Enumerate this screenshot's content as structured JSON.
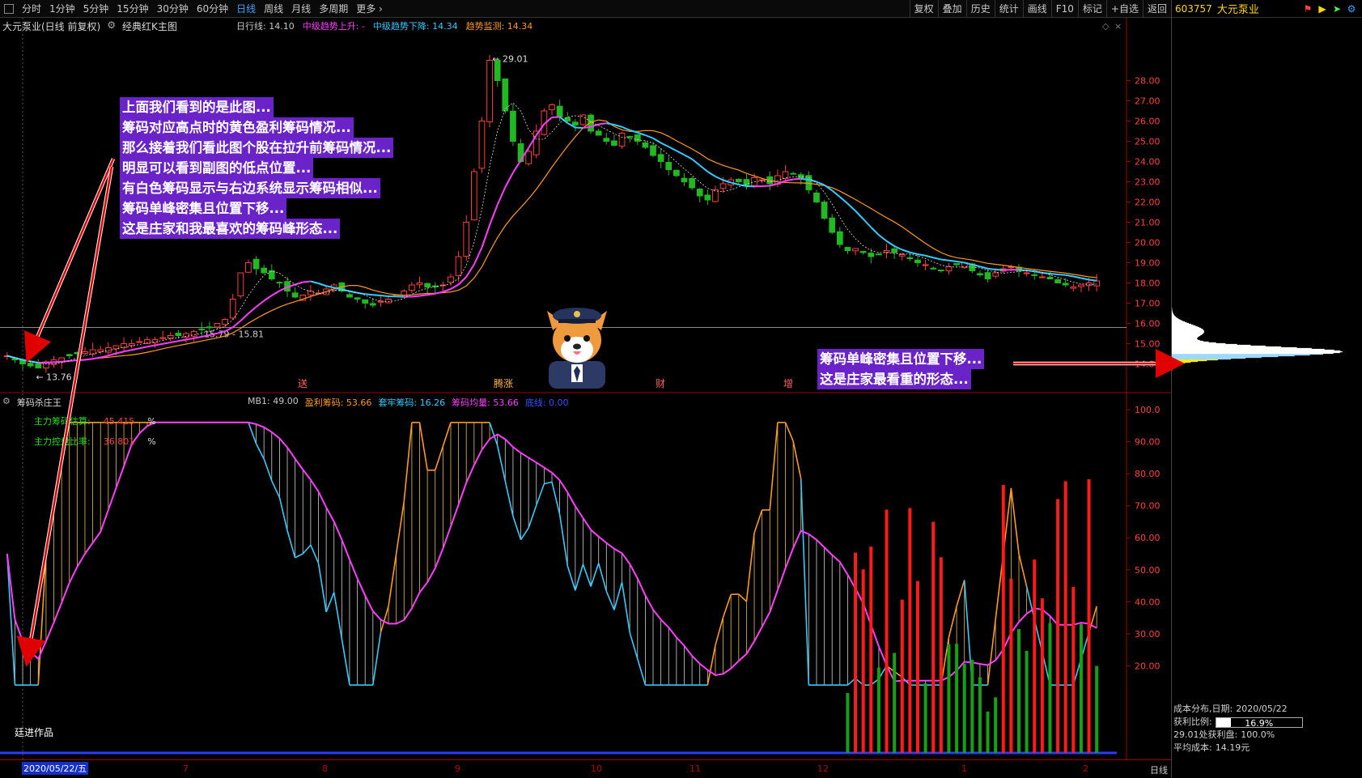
{
  "toolbar": {
    "periods": [
      "分时",
      "1分钟",
      "5分钟",
      "15分钟",
      "30分钟",
      "60分钟",
      "日线",
      "周线",
      "月线",
      "多周期",
      "更多"
    ],
    "active_period": "日线",
    "more_icon": "chevron-right-icon",
    "right_buttons": [
      "复权",
      "叠加",
      "历史",
      "统计",
      "画线",
      "F10",
      "标记",
      "+自选",
      "返回"
    ]
  },
  "stock": {
    "code": "603757",
    "name": "大元泵业",
    "main_title": "大元泵业(日线 前复权)",
    "main_indicator": "经典红K主图"
  },
  "ma_legend": [
    {
      "label": "日行线: 14.10",
      "color": "#c8c8c8"
    },
    {
      "label": "中级趋势上升: -",
      "color": "#ff3cff"
    },
    {
      "label": "中级趋势下降: 14.34",
      "color": "#33ccff"
    },
    {
      "label": "趋势监测: 14.34",
      "color": "#ff9a1f"
    }
  ],
  "price_axis": {
    "labels": [
      "28.00",
      "27.00",
      "26.00",
      "25.00",
      "24.00",
      "23.00",
      "22.00",
      "21.00",
      "20.00",
      "19.00",
      "18.00",
      "17.00",
      "16.00",
      "15.00",
      "14.00"
    ],
    "marker_high": "29.01",
    "marker_low": "13.76",
    "level_label": "15.79 - 15.81"
  },
  "events": [
    {
      "label": "送",
      "color": "#ff6060"
    },
    {
      "label": "腾涨",
      "color": "#ffb040"
    },
    {
      "label": "财",
      "color": "#ff6060"
    },
    {
      "label": "增",
      "color": "#ff6060"
    }
  ],
  "sub_chart": {
    "title": "筹码杀庄王",
    "legend": [
      {
        "label": "MB1: 49.00",
        "color": "#c8c8c8"
      },
      {
        "label": "盈利筹码: 53.66",
        "color": "#ff9a1f"
      },
      {
        "label": "套牢筹码: 16.26",
        "color": "#33ccff"
      },
      {
        "label": "筹码均量: 53.66",
        "color": "#ff3cff"
      },
      {
        "label": "底线: 0.00",
        "color": "#3050ff"
      }
    ],
    "rows": [
      {
        "label": "主力筹码估算:",
        "value": "45.415",
        "unit": "%"
      },
      {
        "label": "主力控盘比率:",
        "value": "36.801",
        "unit": "%"
      }
    ],
    "axis_labels": [
      "100.0",
      "90.00",
      "80.00",
      "70.00",
      "60.00",
      "50.00",
      "40.00",
      "30.00",
      "20.00"
    ],
    "credit": "廷进作品"
  },
  "date_axis": {
    "cursor_date": "2020/05/22/五",
    "months": [
      "7",
      "8",
      "9",
      "10",
      "11",
      "12",
      "1",
      "2"
    ],
    "period": "日线"
  },
  "annotations": {
    "left_note": [
      "上面我们看到的是此图...",
      "筹码对应高点时的黄色盈利筹码情况...",
      "那么接着我们看此图个股在拉升前筹码情况...",
      "明显可以看到副图的低点位置...",
      "有白色筹码显示与右边系统显示筹码相似...",
      "筹码单峰密集且位置下移...",
      "这是庄家和我最喜欢的筹码峰形态..."
    ],
    "right_note": [
      "筹码单峰密集且位置下移...",
      "这是庄家最看重的形态..."
    ]
  },
  "chip_panel": {
    "title": "成本分布,日期:",
    "date": "2020/05/22",
    "profit_ratio_label": "获利比例:",
    "profit_ratio": 16.9,
    "profit_ratio_text": "16.9%",
    "line3": "29.01处获利盘:",
    "line3_value": "100.0%",
    "avg_cost_label": "平均成本:",
    "avg_cost": "14.19元"
  },
  "colors": {
    "up": "#ff3b3b",
    "down": "#22b822",
    "ma_up": "#ff3cff",
    "ma_down": "#33ccff",
    "trend": "#ff9a1f",
    "annotation_bg": "#6a23c9",
    "arrow": "#e00000"
  },
  "chart_data": {
    "type": "candlestick",
    "ylim": [
      13.5,
      29.5
    ],
    "close_series": [
      14.4,
      14.2,
      14.0,
      13.9,
      13.8,
      14.1,
      14.2,
      14.3,
      14.4,
      14.5,
      14.6,
      14.7,
      14.7,
      14.8,
      14.9,
      15.0,
      15.0,
      15.1,
      15.2,
      15.2,
      15.3,
      15.4,
      15.4,
      15.5,
      15.6,
      15.7,
      15.8,
      16.0,
      16.2,
      17.2,
      18.5,
      19.0,
      18.7,
      18.5,
      18.2,
      18.0,
      17.6,
      17.3,
      17.4,
      17.6,
      17.5,
      17.7,
      17.9,
      17.6,
      17.3,
      17.2,
      17.0,
      16.9,
      17.1,
      17.2,
      17.4,
      17.6,
      17.9,
      18.0,
      17.8,
      17.8,
      17.9,
      18.3,
      19.3,
      21.0,
      23.5,
      26.0,
      29.0,
      28.0,
      26.5,
      25.0,
      24.0,
      24.5,
      25.5,
      26.5,
      26.8,
      26.2,
      26.0,
      25.8,
      26.3,
      25.5,
      25.3,
      25.0,
      24.8,
      25.4,
      25.2,
      25.0,
      24.7,
      24.3,
      24.0,
      23.6,
      23.3,
      23.0,
      22.7,
      22.3,
      22.1,
      22.6,
      22.9,
      23.1,
      23.0,
      22.8,
      23.2,
      23.1,
      22.9,
      23.3,
      23.5,
      23.4,
      23.2,
      22.6,
      22.0,
      21.2,
      20.5,
      19.9,
      19.6,
      19.7,
      19.5,
      19.3,
      19.4,
      19.6,
      19.5,
      19.4,
      19.2,
      19.0,
      18.9,
      18.7,
      18.6,
      18.8,
      18.9,
      19.0,
      18.6,
      18.4,
      18.2,
      18.5,
      18.7,
      18.8,
      18.6,
      18.5,
      18.4,
      18.3,
      18.2,
      18.0,
      17.9,
      17.8,
      17.9,
      18.0,
      18.1
    ]
  }
}
